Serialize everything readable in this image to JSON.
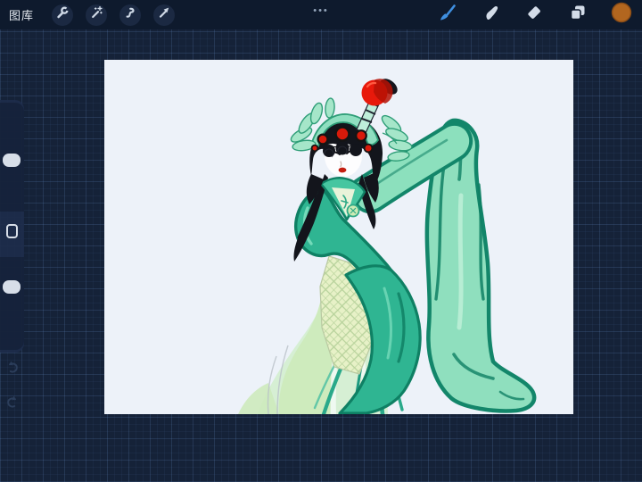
{
  "topbar": {
    "gallery_label": "图库",
    "ellipsis": "•••",
    "left_tools": [
      {
        "name": "actions",
        "icon": "wrench-icon"
      },
      {
        "name": "adjustments",
        "icon": "magic-wand-icon"
      },
      {
        "name": "selection",
        "icon": "selection-s-icon"
      },
      {
        "name": "transform",
        "icon": "transform-arrow-icon"
      }
    ],
    "right_tools": [
      {
        "name": "paint",
        "icon": "paintbrush-icon",
        "active": true
      },
      {
        "name": "smudge",
        "icon": "smudge-finger-icon",
        "active": false
      },
      {
        "name": "erase",
        "icon": "eraser-icon",
        "active": false
      },
      {
        "name": "layers",
        "icon": "layers-icon",
        "active": false
      },
      {
        "name": "color",
        "icon": "color-swatch",
        "active": false
      }
    ],
    "colors": {
      "bar_bg": "#0e1a2d",
      "icon_circle_bg": "#1b2942",
      "icon_glyph": "#cfd9e6",
      "active_tool_blue": "#3f8fe0",
      "color_swatch_orange": "#b2661f"
    }
  },
  "sidebar": {
    "sliders": [
      {
        "name": "brush-size",
        "handle_position": "upper"
      },
      {
        "name": "opacity",
        "handle_position": "upper"
      }
    ],
    "modify_button": "square",
    "history": [
      {
        "name": "undo",
        "icon": "undo-arrow-icon"
      },
      {
        "name": "redo",
        "icon": "redo-arrow-icon"
      }
    ]
  },
  "canvas": {
    "background": "#edf2f9",
    "artwork_subject": "Chinese opera performer in mint-teal flowing robes with red pompom headdress",
    "palette": {
      "mint": "#8fdfbe",
      "teal": "#2fb592",
      "dark_teal": "#0f8064",
      "red": "#e8190b",
      "black": "#13151c",
      "pale_bodice": "#e7f1c7"
    }
  }
}
